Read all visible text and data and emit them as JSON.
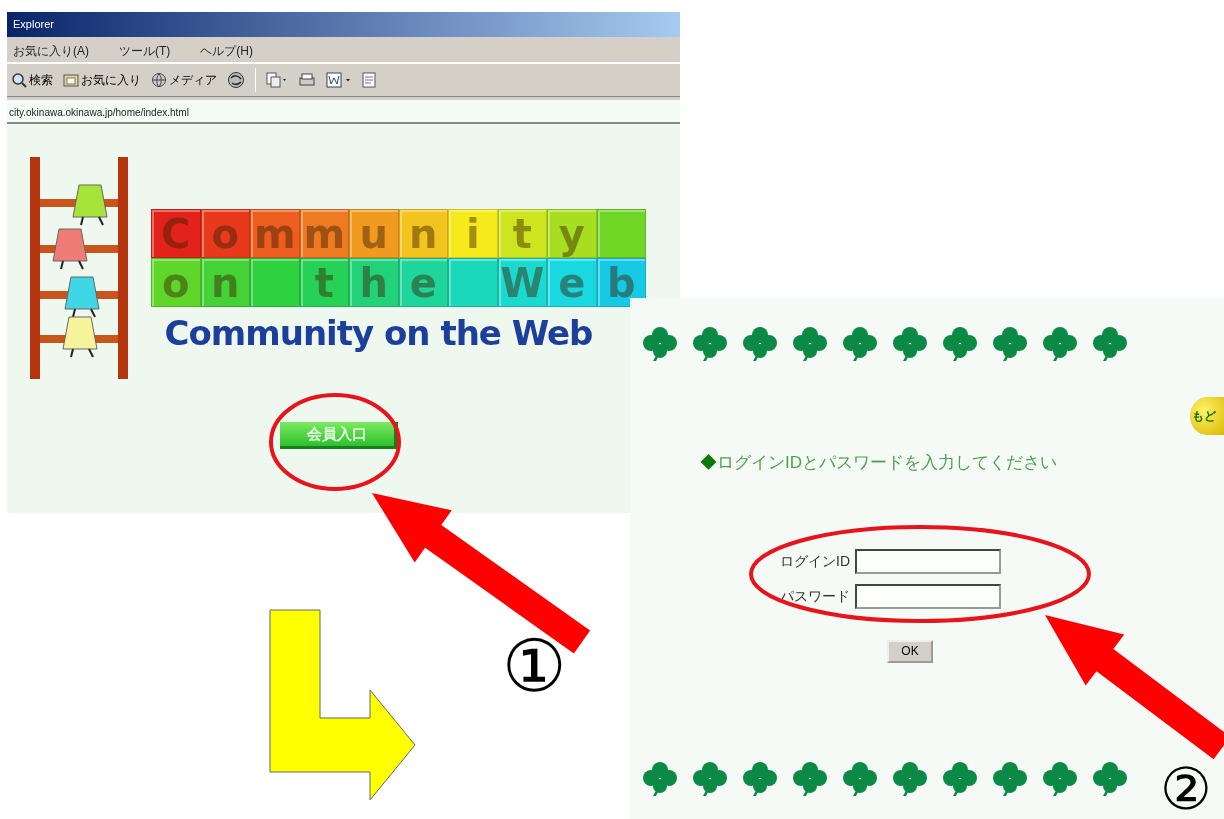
{
  "browser_window": {
    "title": "Explorer",
    "menu": [
      "お気に入り(A)",
      "ツール(T)",
      "ヘルプ(H)"
    ],
    "toolbar": [
      "検索",
      "お気に入り",
      "メディア"
    ],
    "address": "city.okinawa.okinawa.jp/home/index.html",
    "page": {
      "logo_tiles": [
        {
          "letter": "C",
          "color": "#e3231b"
        },
        {
          "letter": "o",
          "color": "#e8391d"
        },
        {
          "letter": "m",
          "color": "#ec5d1f"
        },
        {
          "letter": "m",
          "color": "#ee7a22"
        },
        {
          "letter": "u",
          "color": "#f19a20"
        },
        {
          "letter": "n",
          "color": "#f3c41f"
        },
        {
          "letter": "i",
          "color": "#f6ea1c"
        },
        {
          "letter": "t",
          "color": "#cde51e"
        },
        {
          "letter": "y",
          "color": "#a8de22"
        },
        {
          "color": "#6fd626"
        },
        {
          "letter": "o",
          "color": "#5fd62a"
        },
        {
          "letter": "n",
          "color": "#45d236"
        },
        {
          "color": "#2ed13e"
        },
        {
          "letter": "t",
          "color": "#26d158"
        },
        {
          "letter": "h",
          "color": "#21d27a"
        },
        {
          "letter": "e",
          "color": "#1ed59b"
        },
        {
          "color": "#1cd8bb"
        },
        {
          "letter": "W",
          "color": "#1ad9cf"
        },
        {
          "letter": "e",
          "color": "#19d8df"
        },
        {
          "letter": "b",
          "color": "#18c9e6"
        }
      ],
      "logo_text": "Community on the Web",
      "member_button": "会員入口"
    }
  },
  "login_page": {
    "back_badge": "もど",
    "instruction_bullet": "◆",
    "instruction": "ログインIDとパスワードを入力してください",
    "fields": [
      {
        "label": "ログインID"
      },
      {
        "label": "パスワード"
      }
    ],
    "submit": "OK"
  },
  "step_markers": [
    "①",
    "②"
  ]
}
